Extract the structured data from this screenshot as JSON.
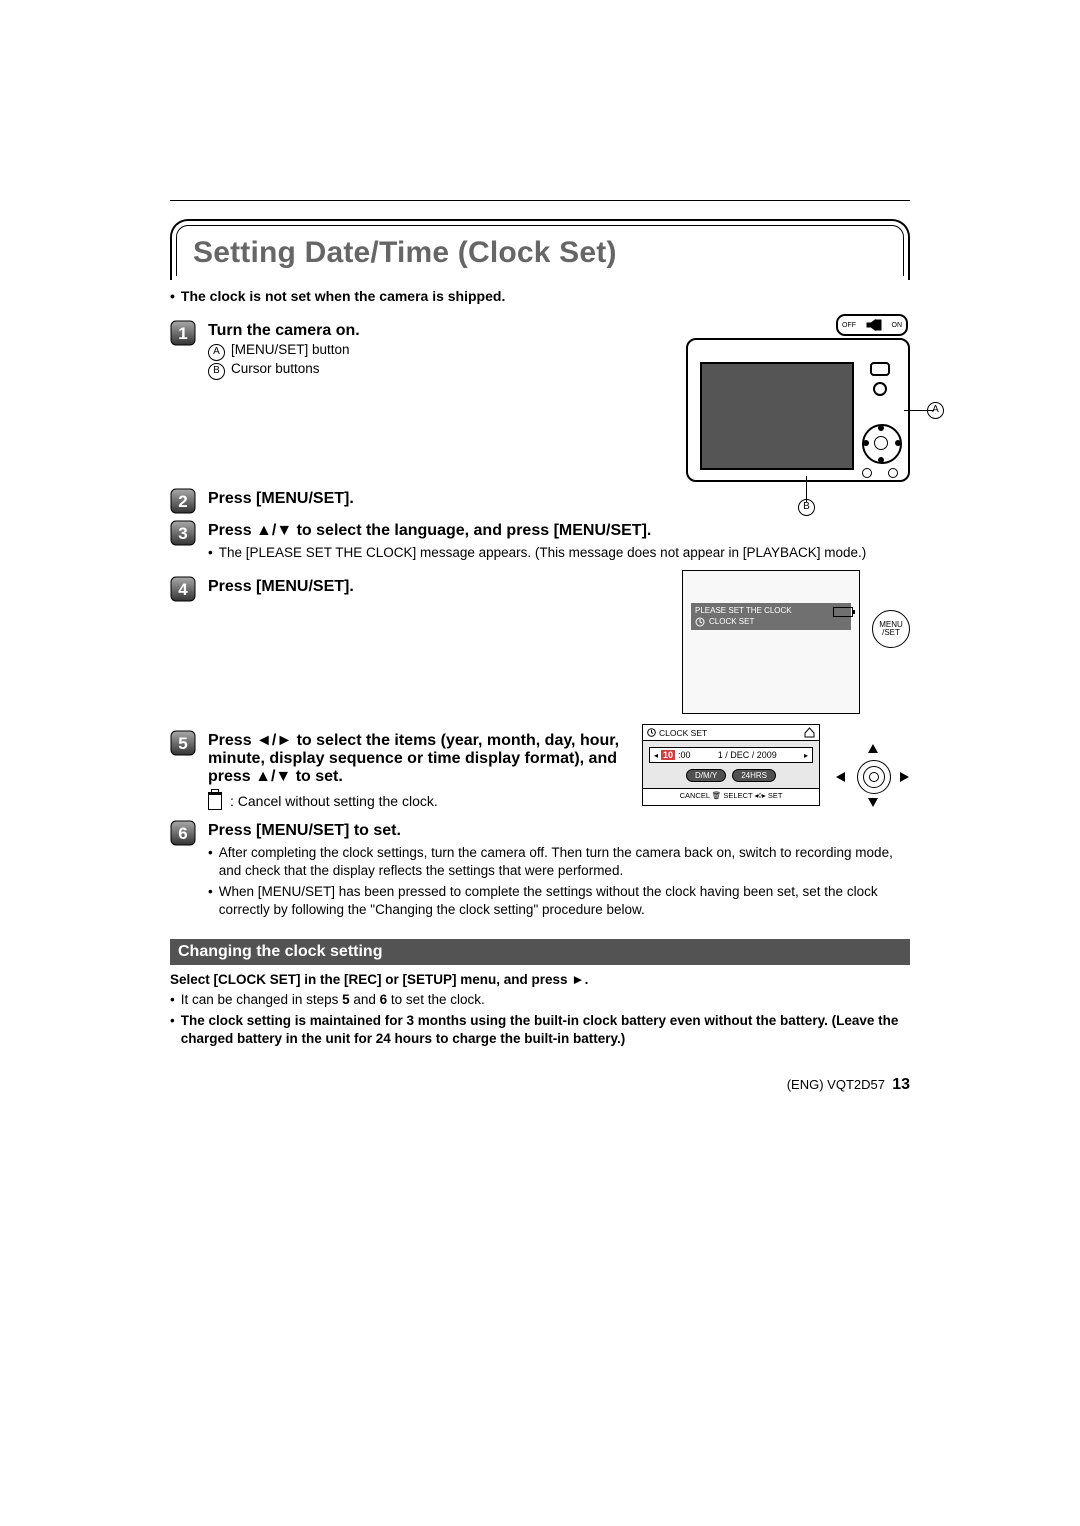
{
  "title": "Setting Date/Time (Clock Set)",
  "intro": "The clock is not set when the camera is shipped.",
  "step1": {
    "head": "Turn the camera on.",
    "a_label": "[MENU/SET] button",
    "b_label": "Cursor buttons"
  },
  "camera_switch": {
    "off": "OFF",
    "on": "ON"
  },
  "anno_a": "A",
  "anno_b": "B",
  "step2": {
    "head": "Press [MENU/SET]."
  },
  "step3": {
    "head": "Press ▲/▼ to select the language, and press [MENU/SET].",
    "bullet": "The [PLEASE SET THE CLOCK] message appears. (This message does not appear in [PLAYBACK] mode.)"
  },
  "step4": {
    "head": "Press [MENU/SET]."
  },
  "lcd1": {
    "line1": "PLEASE SET THE CLOCK",
    "line2": "CLOCK SET",
    "btn_l1": "MENU",
    "btn_l2": "/SET"
  },
  "step5": {
    "head": "Press ◄/► to select the items (year, month, day, hour, minute, display sequence or time display format), and press ▲/▼ to set."
  },
  "trash_note": ": Cancel without setting the clock.",
  "lcd2": {
    "header": "CLOCK SET",
    "hh": "10",
    "mm": ":00",
    "date": "1 / DEC / 2009",
    "fmt1": "D/M/Y",
    "fmt2": "24HRS",
    "footer": "CANCEL 🗑 SELECT ◂◊▸ SET"
  },
  "step6": {
    "head": "Press [MENU/SET] to set.",
    "b1": "After completing the clock settings, turn the camera off. Then turn the camera back on, switch to recording mode, and check that the display reflects the settings that were performed.",
    "b2": "When [MENU/SET] has been pressed to complete the settings without the clock having been set, set the clock correctly by following the \"Changing the clock setting\" procedure below."
  },
  "section2": {
    "title": "Changing the clock setting",
    "lead": "Select [CLOCK SET] in the [REC] or [SETUP] menu, and press ►.",
    "b1_pre": "It can be changed in steps ",
    "b1_mid": " and ",
    "b1_post": " to set the clock.",
    "b1_n1": "5",
    "b1_n2": "6",
    "b2": "The clock setting is maintained for 3 months using the built-in clock battery even without the battery. (Leave the charged battery in the unit for 24 hours to charge the built-in battery.)"
  },
  "footer": {
    "doc": "(ENG) VQT2D57",
    "page": "13"
  }
}
